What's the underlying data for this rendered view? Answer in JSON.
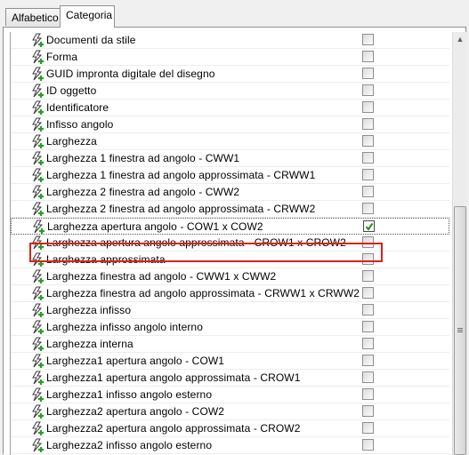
{
  "tabs": [
    {
      "label": "Alfabetico",
      "active": false
    },
    {
      "label": "Categoria",
      "active": true
    }
  ],
  "properties": [
    {
      "label": "Documenti da stile",
      "checked": false
    },
    {
      "label": "Forma",
      "checked": false
    },
    {
      "label": "GUID impronta digitale del disegno",
      "checked": false
    },
    {
      "label": "ID oggetto",
      "checked": false
    },
    {
      "label": "Identificatore",
      "checked": false
    },
    {
      "label": "Infisso angolo",
      "checked": false
    },
    {
      "label": "Larghezza",
      "checked": false
    },
    {
      "label": "Larghezza 1 finestra ad angolo - CWW1",
      "checked": false
    },
    {
      "label": "Larghezza 1 finestra ad angolo approssimata - CRWW1",
      "checked": false
    },
    {
      "label": "Larghezza 2 finestra ad angolo - CWW2",
      "checked": false
    },
    {
      "label": "Larghezza 2 finestra ad angolo approssimata - CRWW2",
      "checked": false
    },
    {
      "label": "Larghezza apertura angolo - COW1 x COW2",
      "checked": true,
      "selected": true
    },
    {
      "label": "Larghezza apertura angolo approssimata - CROW1 x CROW2",
      "checked": false
    },
    {
      "label": "Larghezza approssimata",
      "checked": false
    },
    {
      "label": "Larghezza finestra ad angolo - CWW1 x CWW2",
      "checked": false
    },
    {
      "label": "Larghezza finestra ad angolo approssimata - CRWW1 x CRWW2",
      "checked": false
    },
    {
      "label": "Larghezza infisso",
      "checked": false
    },
    {
      "label": "Larghezza infisso angolo interno",
      "checked": false
    },
    {
      "label": "Larghezza interna",
      "checked": false
    },
    {
      "label": "Larghezza1 apertura angolo - COW1",
      "checked": false
    },
    {
      "label": "Larghezza1 apertura angolo approssimata - CROW1",
      "checked": false
    },
    {
      "label": "Larghezza1 infisso angolo esterno",
      "checked": false
    },
    {
      "label": "Larghezza2 apertura angolo - COW2",
      "checked": false
    },
    {
      "label": "Larghezza2 apertura angolo approssimata - CROW2",
      "checked": false
    },
    {
      "label": "Larghezza2 infisso angolo esterno",
      "checked": false
    }
  ],
  "icon": "property-lightning-icon",
  "colors": {
    "highlight": "#e0201a",
    "icon_green": "#2e9a2e"
  }
}
